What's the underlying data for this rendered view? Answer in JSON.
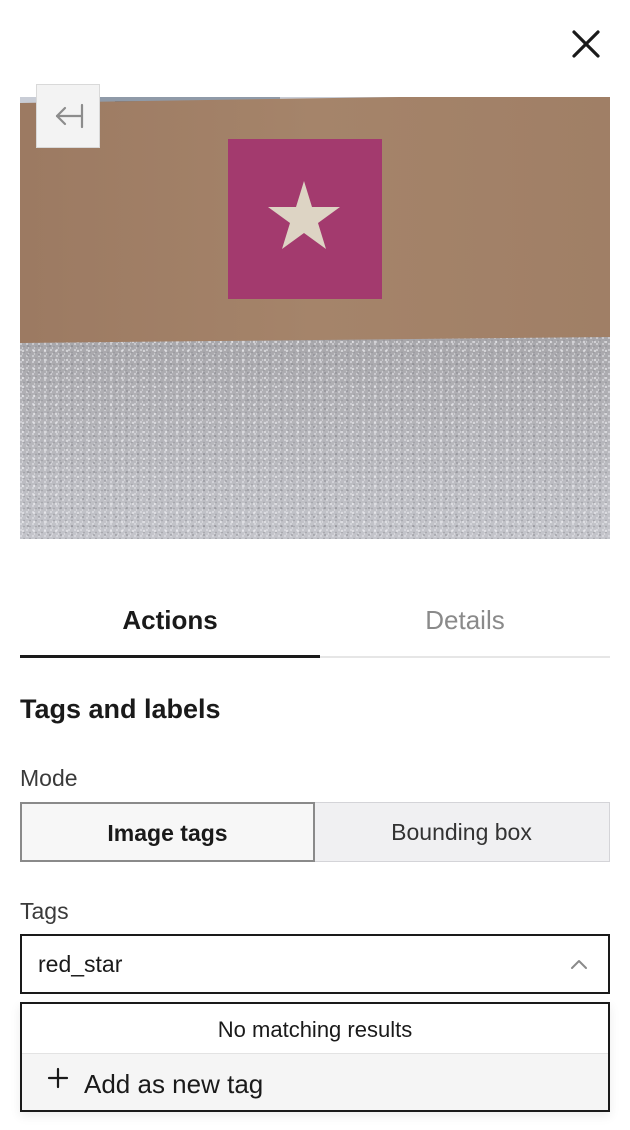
{
  "header": {
    "close_icon": "close-icon",
    "collapse_icon": "collapse-left-icon"
  },
  "tabs": [
    {
      "label": "Actions",
      "active": true
    },
    {
      "label": "Details",
      "active": false
    }
  ],
  "section": {
    "title": "Tags and labels"
  },
  "mode": {
    "label": "Mode",
    "options": [
      "Image tags",
      "Bounding box"
    ],
    "selected": "Image tags"
  },
  "tags": {
    "label": "Tags",
    "value": "red_star",
    "chevron_icon": "chevron-up-icon"
  },
  "dropdown": {
    "no_results": "No matching results",
    "add_label": "Add as new tag",
    "add_icon": "plus-icon"
  },
  "colors": {
    "text": "#1a1a1a",
    "muted": "#8a8a8a",
    "border": "#1a1a1a",
    "card_magenta": "#a33a6e"
  }
}
